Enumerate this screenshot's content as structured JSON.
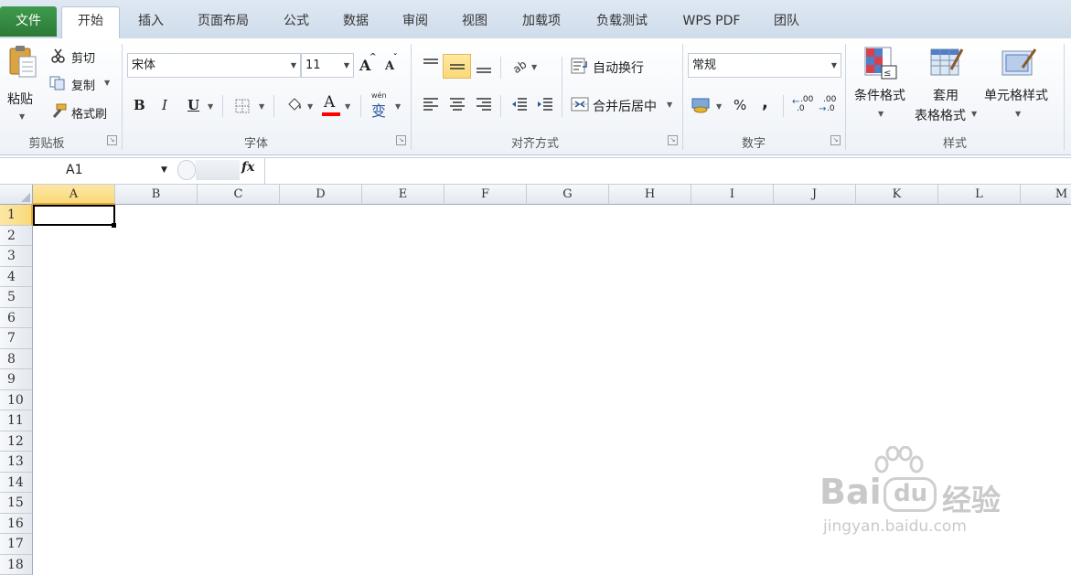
{
  "menu": {
    "tabs": [
      {
        "id": "file",
        "label": "文件"
      },
      {
        "id": "home",
        "label": "开始"
      },
      {
        "id": "insert",
        "label": "插入"
      },
      {
        "id": "page_layout",
        "label": "页面布局"
      },
      {
        "id": "formulas",
        "label": "公式"
      },
      {
        "id": "data",
        "label": "数据"
      },
      {
        "id": "review",
        "label": "审阅"
      },
      {
        "id": "view",
        "label": "视图"
      },
      {
        "id": "addins",
        "label": "加载项"
      },
      {
        "id": "load_test",
        "label": "负载测试"
      },
      {
        "id": "wps_pdf",
        "label": "WPS PDF"
      },
      {
        "id": "team",
        "label": "团队"
      }
    ],
    "active_tab": "home"
  },
  "ribbon": {
    "clipboard": {
      "paste_label": "粘贴",
      "cut_label": "剪切",
      "copy_label": "复制",
      "format_painter_label": "格式刷",
      "group_label": "剪贴板"
    },
    "font": {
      "font_name": "宋体",
      "font_size": "11",
      "bold_label": "B",
      "italic_label": "I",
      "underline_label": "U",
      "font_color_letter": "A",
      "grow_label": "A",
      "shrink_label": "A",
      "phonetic_label": "wén",
      "phonetic_char": "变",
      "group_label": "字体",
      "font_color": "#ff0000"
    },
    "alignment": {
      "wrap_text_label": "自动换行",
      "merge_center_label": "合并后居中",
      "group_label": "对齐方式"
    },
    "number": {
      "format_value": "常规",
      "percent_label": "%",
      "comma_label": ",",
      "increase_decimal_label": ".00",
      "decrease_decimal_label": ".00",
      "group_label": "数字"
    },
    "styles": {
      "conditional_format_label": "条件格式",
      "table_format_line1": "套用",
      "table_format_line2": "表格格式",
      "cell_styles_label": "单元格样式",
      "group_label": "样式"
    }
  },
  "formula_bar": {
    "name_box": "A1",
    "fx_label": "fx",
    "formula_value": ""
  },
  "sheet": {
    "columns": [
      "A",
      "B",
      "C",
      "D",
      "E",
      "F",
      "G",
      "H",
      "I",
      "J",
      "K",
      "L",
      "M"
    ],
    "rows": [
      "1",
      "2",
      "3",
      "4",
      "5",
      "6",
      "7",
      "8",
      "9",
      "10",
      "11",
      "12",
      "13",
      "14",
      "15",
      "16",
      "17",
      "18"
    ],
    "selected_cell": "A1"
  },
  "watermark": {
    "brand": "Bai",
    "brand_mid": "du",
    "brand_cn": "经验",
    "url": "jingyan.baidu.com"
  },
  "colors": {
    "file_tab": "#2e7d3a",
    "selection_header": "#f9d978",
    "accent_blue": "#2b579a"
  }
}
